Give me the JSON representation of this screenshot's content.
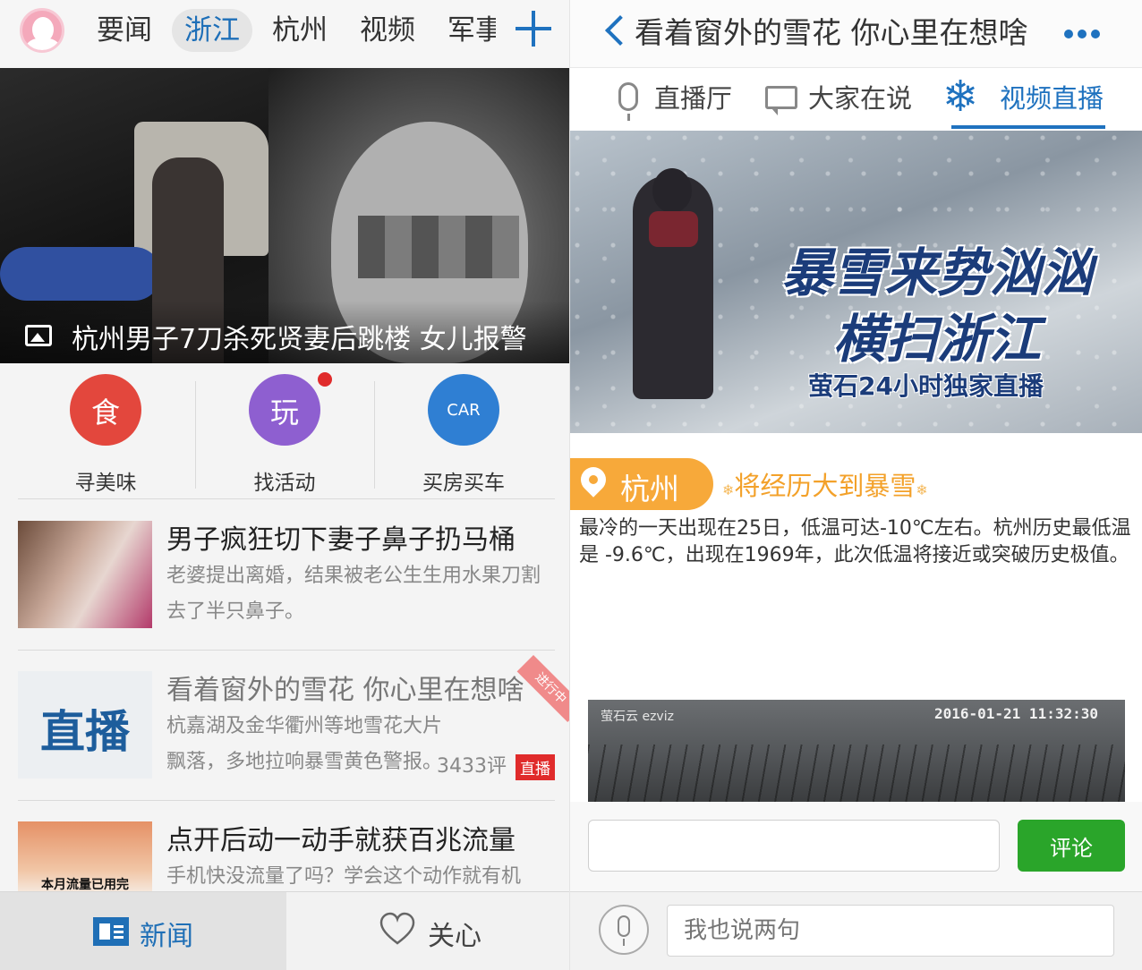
{
  "left": {
    "nav": {
      "tabs": [
        "要闻",
        "浙江",
        "杭州",
        "视频",
        "军事"
      ],
      "active": "浙江"
    },
    "hero": {
      "caption": "杭州男子7刀杀死贤妻后跳楼 女儿报警"
    },
    "shortcuts": [
      {
        "label": "寻美味",
        "color": "#e3473d",
        "glyph": "食"
      },
      {
        "label": "找活动",
        "color": "#8e5fd0",
        "glyph": "玩"
      },
      {
        "label": "买房买车",
        "color": "#2f7fd3",
        "glyph": "CAR"
      }
    ],
    "news": [
      {
        "title": "男子疯狂切下妻子鼻子扔马桶",
        "desc": "老婆提出离婚，结果被老公生生用水果刀割去了半只鼻子。"
      },
      {
        "title": "看着窗外的雪花 你心里在想啥",
        "desc": "杭嘉湖及金华衢州等地雪花大片飘落，多地拉响暴雪黄色警报。",
        "comments": "3433评",
        "badge": "直播",
        "ribbon": "进行中",
        "thumb_text": "直播"
      },
      {
        "title": "点开后动一动手就获百兆流量",
        "desc": "手机快没流量了吗？学会这个动作就有机",
        "thumb_text": "本月流量已用完"
      }
    ],
    "bottom": {
      "news_label": "新闻",
      "care_label": "关心"
    }
  },
  "right": {
    "header": {
      "title": "看着窗外的雪花 你心里在想啥"
    },
    "tabs": [
      "直播厅",
      "大家在说",
      "视频直播"
    ],
    "active_tab": "视频直播",
    "banner": {
      "title_line1": "暴雪来势汹汹",
      "title_line2": "横扫浙江",
      "subtitle": "萤石24小时独家直播"
    },
    "location": {
      "city": "杭州",
      "headline": "将经历大到暴雪",
      "description": "最冷的一天出现在25日，低温可达-10℃左右。杭州历史最低温是 -9.6℃，出现在1969年，此次低温将接近或突破历史极值。"
    },
    "camera": {
      "logo": "萤石云 ezviz",
      "timestamp": "2016-01-21 11:32:30"
    },
    "comment": {
      "input_value": "",
      "button_label": "评论"
    },
    "bottom": {
      "placeholder": "我也说两句"
    },
    "colors": {
      "accent_blue": "#1f72bf",
      "green_button": "#2aa52a",
      "orange": "#f7a93a",
      "live_red": "#e02b2b"
    }
  }
}
